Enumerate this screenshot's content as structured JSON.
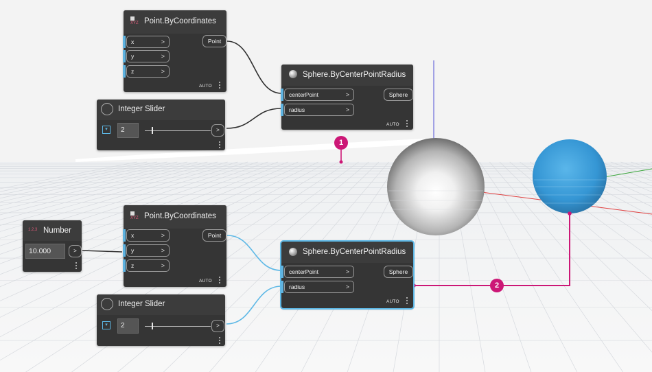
{
  "colors": {
    "accent": "#5db8e6",
    "wire_default": "#2f2f2f",
    "wire_selected": "#5db8e6",
    "annotation": "#cc1776",
    "sphere_selected": "#3d9bd6"
  },
  "top_group": {
    "point_node": {
      "title": "Point.ByCoordinates",
      "icon": "xyz-icon",
      "inputs": [
        "x",
        "y",
        "z"
      ],
      "output": "Point",
      "lacing": "AUTO"
    },
    "slider_node": {
      "title": "Integer Slider",
      "icon": "slider-icon",
      "value": "2"
    },
    "sphere_node": {
      "title": "Sphere.ByCenterPointRadius",
      "icon": "sphere-icon",
      "inputs": [
        "centerPoint",
        "radius"
      ],
      "output": "Sphere",
      "lacing": "AUTO"
    }
  },
  "bottom_group": {
    "number_node": {
      "title": "Number",
      "icon": "number-123-icon",
      "value": "10.000"
    },
    "point_node": {
      "title": "Point.ByCoordinates",
      "icon": "xyz-icon",
      "inputs": [
        "x",
        "y",
        "z"
      ],
      "output": "Point",
      "lacing": "AUTO"
    },
    "slider_node": {
      "title": "Integer Slider",
      "icon": "slider-icon",
      "value": "2"
    },
    "sphere_node": {
      "title": "Sphere.ByCenterPointRadius",
      "icon": "sphere-icon",
      "inputs": [
        "centerPoint",
        "radius"
      ],
      "output": "Sphere",
      "lacing": "AUTO",
      "selected": true
    }
  },
  "port_arrow": ">",
  "callouts": [
    "1",
    "2"
  ],
  "icons_misc": {
    "header_number_icon": "1.2.3",
    "xyz_icon": "XYZ"
  }
}
